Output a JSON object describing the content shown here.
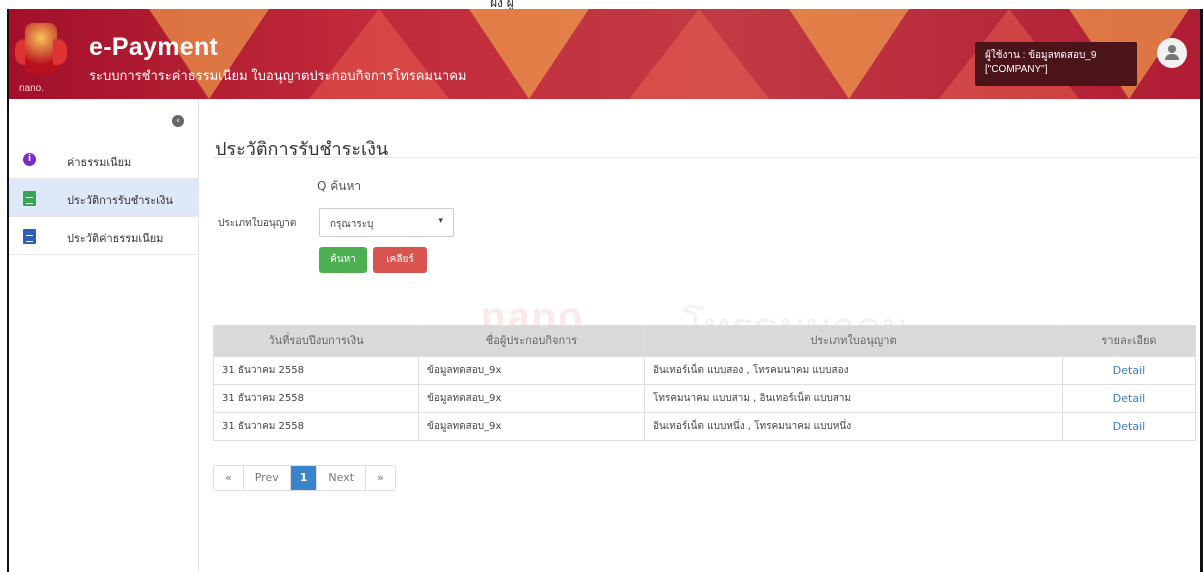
{
  "header": {
    "logo_text": "nano.",
    "app_title": "e-Payment",
    "app_subtitle": "ระบบการชำระค่าธรรมเนียม ใบอนุญาตประกอบกิจการโทรคมนาคม",
    "user_line1": "ผู้ใช้งาน : ข้อมูลทดสอบ_9",
    "user_line2": "[\"COMPANY\"]",
    "top_crop_text": "ฝั่ง ผู้"
  },
  "sidebar": {
    "collapse_glyph": "‹",
    "items": [
      {
        "label": "ค่าธรรมเนียม",
        "icon": "info-icon",
        "active": false
      },
      {
        "label": "ประวัติการรับชำระเงิน",
        "icon": "document-icon",
        "active": true
      },
      {
        "label": "ประวัติค่าธรรมเนียม",
        "icon": "document-icon",
        "active": false
      }
    ]
  },
  "main": {
    "page_title": "ประวัติการรับชำระเงิน",
    "search_heading": "Q ค้นหา",
    "filter_label": "ประเภทใบอนุญาต",
    "filter_select_value": "กรุณาระบุ",
    "search_button": "ค้นหา",
    "clear_button": "เคลียร์",
    "watermark_left": "nano",
    "watermark_right": "โทรคมนาคม"
  },
  "table": {
    "columns": [
      "วันที่รอบปีงบการเงิน",
      "ชื่อผู้ประกอบกิจการ",
      "ประเภทใบอนุญาต",
      "รายละเอียด"
    ],
    "rows": [
      [
        "31 ธันวาคม 2558",
        "ข้อมูลทดสอบ_9x",
        "อินเทอร์เน็ต แบบสอง , โทรคมนาคม แบบสอง",
        "Detail"
      ],
      [
        "31 ธันวาคม 2558",
        "ข้อมูลทดสอบ_9x",
        "โทรคมนาคม แบบสาม , อินเทอร์เน็ต แบบสาม",
        "Detail"
      ],
      [
        "31 ธันวาคม 2558",
        "ข้อมูลทดสอบ_9x",
        "อินเทอร์เน็ต แบบหนึ่ง , โทรคมนาคม แบบหนึ่ง",
        "Detail"
      ]
    ]
  },
  "pagination": {
    "first": "«",
    "prev": "Prev",
    "current": "1",
    "next": "Next",
    "last": "»"
  },
  "colors": {
    "header_red": "#c12a3a",
    "active_item_bg": "#dde9f8",
    "search_green": "#4caf50",
    "clear_red": "#d9534f",
    "pager_active": "#3c84c9",
    "link_blue": "#3d7cc9"
  }
}
